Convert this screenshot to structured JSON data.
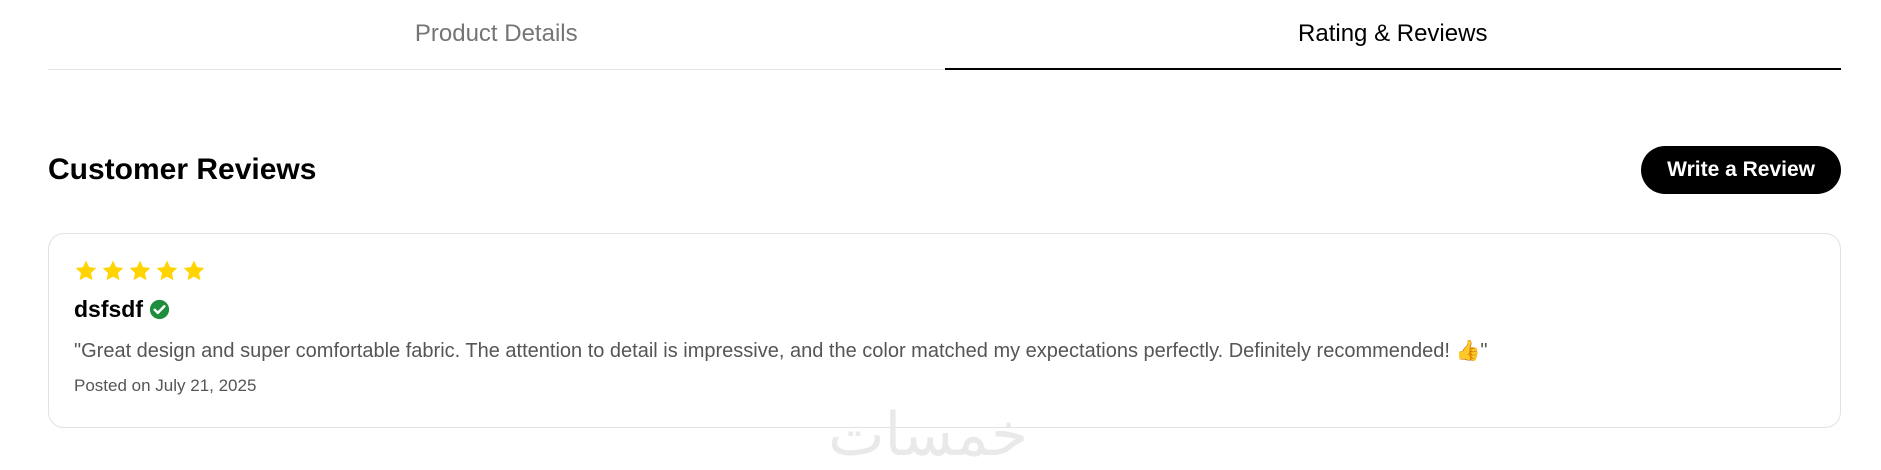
{
  "tabs": [
    {
      "label": "Product Details",
      "active": false
    },
    {
      "label": "Rating & Reviews",
      "active": true
    }
  ],
  "reviews": {
    "title": "Customer Reviews",
    "write_button_label": "Write a Review",
    "items": [
      {
        "rating": 5,
        "max_rating": 5,
        "star_color": "#FFD400",
        "reviewer": "dsfsdf",
        "verified": true,
        "verified_color": "#1E8E3E",
        "text": "\"Great design and super comfortable fabric. The attention to detail is impressive, and the color matched my expectations perfectly. Definitely recommended! 👍\"",
        "date": "Posted on July 21, 2025"
      }
    ]
  },
  "watermark": {
    "text": "خمسات"
  },
  "icons": {
    "star": "star-icon",
    "verified": "verified-check-icon"
  }
}
